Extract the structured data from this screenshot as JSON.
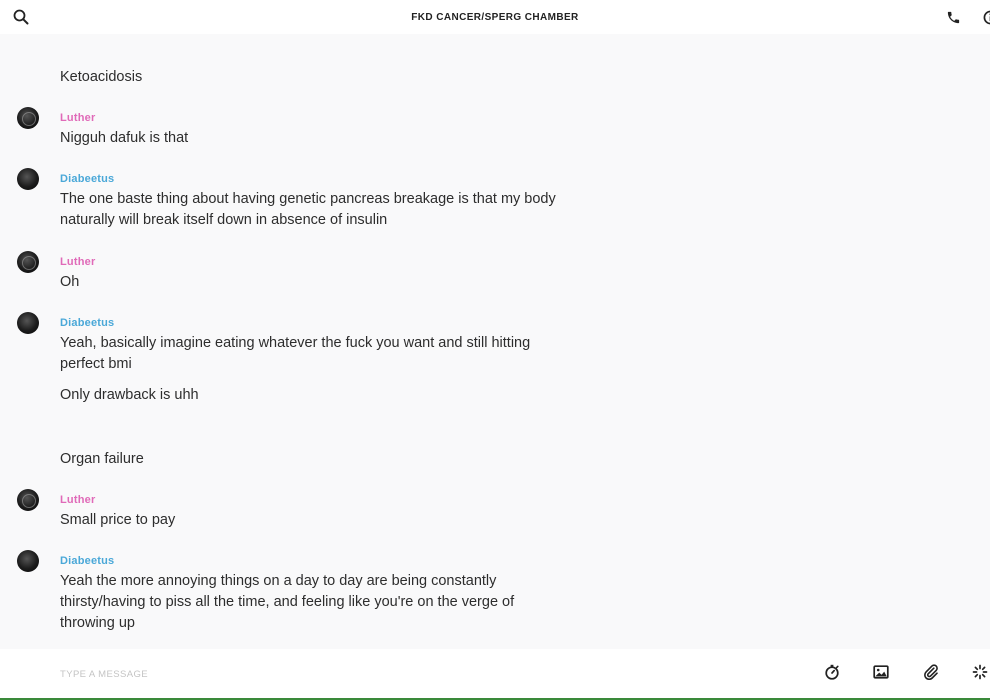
{
  "header": {
    "title": "FKD CANCER/SPERG CHAMBER"
  },
  "messages": [
    {
      "text": "Ketoacidosis"
    },
    {
      "sender": "Luther",
      "sender_color": "#e06ab8",
      "text": "Nigguh dafuk is that"
    },
    {
      "sender": "Diabeetus",
      "sender_color": "#4aa8d8",
      "text": "The one baste thing about having genetic pancreas breakage is that my body naturally will break itself down in absence of insulin"
    },
    {
      "sender": "Luther",
      "sender_color": "#e06ab8",
      "text": "Oh"
    },
    {
      "sender": "Diabeetus",
      "sender_color": "#4aa8d8",
      "text": "Yeah, basically imagine eating whatever the fuck you want and still hitting perfect bmi"
    },
    {
      "text": "Only drawback is uhh"
    },
    {
      "text": "Organ failure"
    },
    {
      "sender": "Luther",
      "sender_color": "#e06ab8",
      "text": "Small price to pay"
    },
    {
      "sender": "Diabeetus",
      "sender_color": "#4aa8d8",
      "text": "Yeah the more annoying things on a day to day are being constantly thirsty/having to piss all the time, and feeling like you're on the verge of throwing up"
    }
  ],
  "composer": {
    "placeholder": "TYPE A MESSAGE",
    "value": ""
  },
  "icons": {
    "search": "search-icon",
    "call": "phone-icon",
    "info": "info-icon",
    "timer": "timer-icon",
    "image": "image-icon",
    "attach": "paperclip-icon",
    "sparkle": "sparkle-icon"
  }
}
